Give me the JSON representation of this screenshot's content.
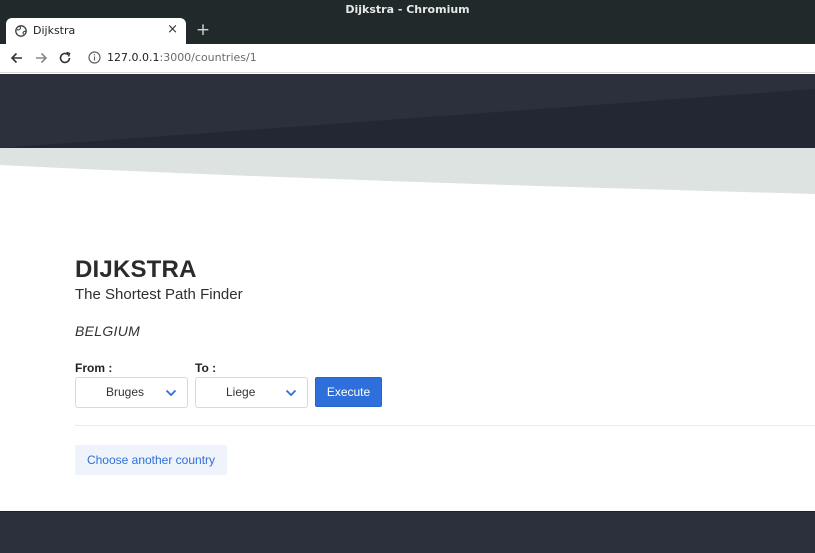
{
  "window": {
    "title": "Dijkstra - Chromium"
  },
  "tab": {
    "title": "Dijkstra"
  },
  "toolbar": {
    "url_host": "127.0.0.1",
    "url_rest": ":3000/countries/1"
  },
  "header": {
    "title": "DIJKSTRA",
    "subtitle": "The Shortest Path Finder",
    "country": "BELGIUM"
  },
  "form": {
    "from_label": "From :",
    "from_value": "Bruges",
    "to_label": "To :",
    "to_value": "Liege",
    "execute_label": "Execute"
  },
  "actions": {
    "choose_country_label": "Choose another country"
  },
  "colors": {
    "hero_dark": "#2b303c",
    "hero_darker": "#222733",
    "wave": "#dde3e1",
    "accent": "#2f6fdb"
  },
  "icons": [
    "globe-icon",
    "close-icon",
    "plus-icon",
    "arrow-left-icon",
    "arrow-right-icon",
    "reload-icon",
    "info-icon",
    "chevron-down-icon"
  ]
}
